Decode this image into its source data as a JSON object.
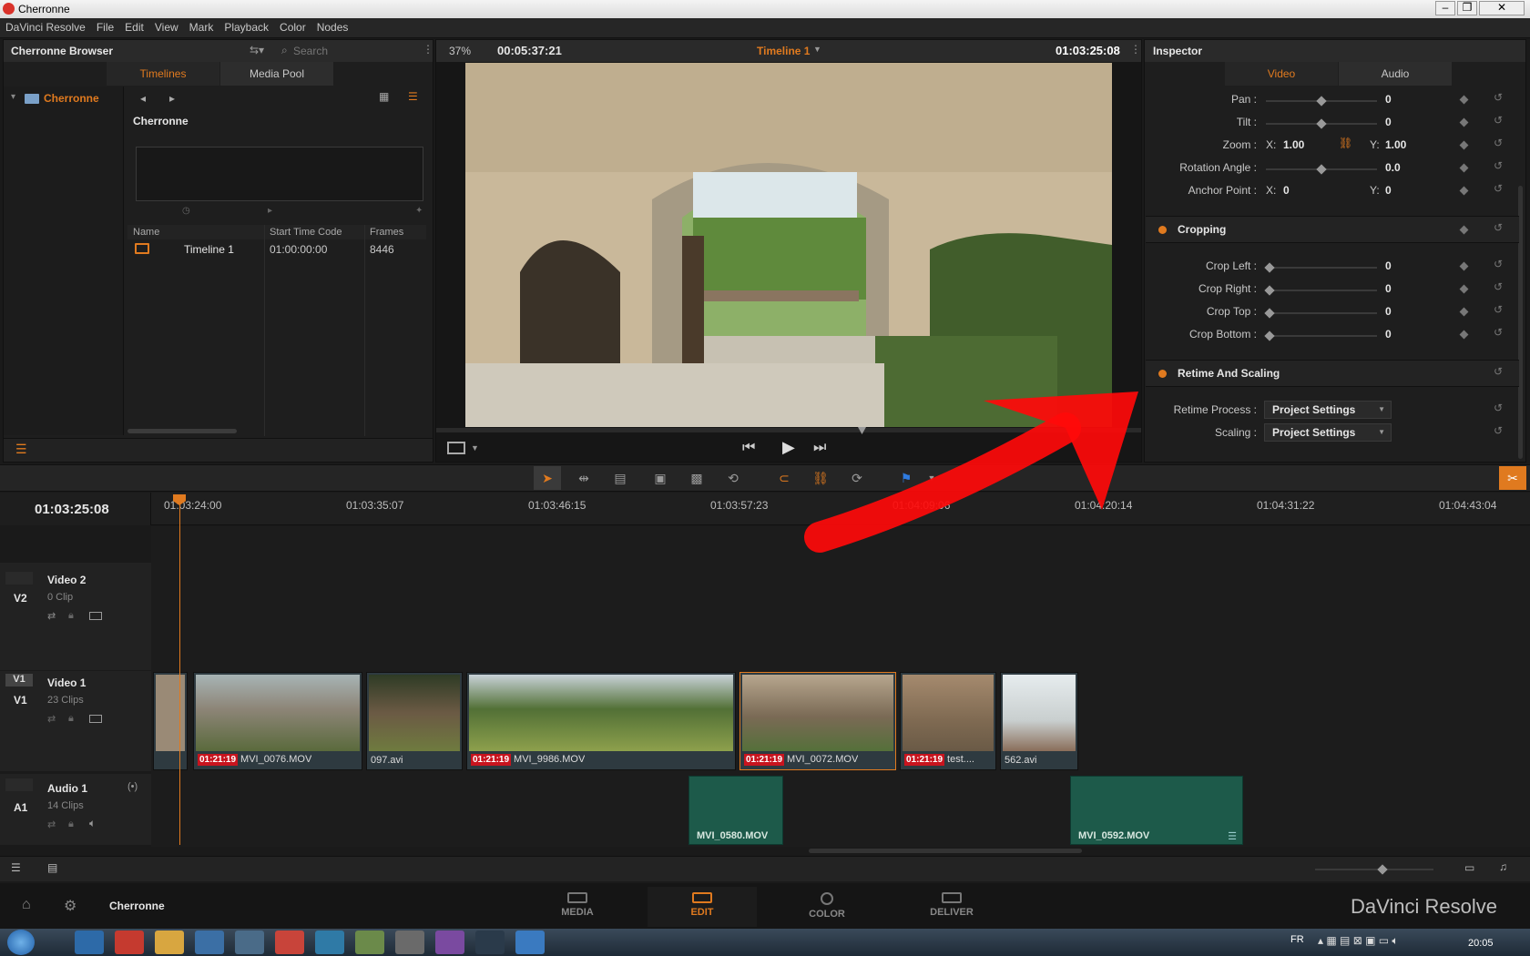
{
  "window": {
    "title": "Cherronne"
  },
  "menu": [
    "DaVinci Resolve",
    "File",
    "Edit",
    "View",
    "Mark",
    "Playback",
    "Color",
    "Nodes"
  ],
  "browser": {
    "title": "Cherronne Browser",
    "search_placeholder": "Search",
    "tabs": [
      "Timelines",
      "Media Pool"
    ],
    "active_tab": "Timelines",
    "tree_item": "Cherronne",
    "folder_title": "Cherronne",
    "columns": [
      "Name",
      "Start Time Code",
      "Frames"
    ],
    "rows": [
      {
        "name": "Timeline 1",
        "start": "01:00:00:00",
        "frames": "8446"
      }
    ]
  },
  "viewer": {
    "zoom": "37%",
    "duration": "00:05:37:21",
    "timeline_name": "Timeline 1",
    "timecode": "01:03:25:08"
  },
  "inspector": {
    "title": "Inspector",
    "tabs": [
      "Video",
      "Audio"
    ],
    "active_tab": "Video",
    "pan": {
      "label": "Pan :",
      "value": "0"
    },
    "tilt": {
      "label": "Tilt :",
      "value": "0"
    },
    "zoom": {
      "label": "Zoom :",
      "x_label": "X:",
      "x": "1.00",
      "y_label": "Y:",
      "y": "1.00"
    },
    "rotation": {
      "label": "Rotation Angle :",
      "value": "0.0"
    },
    "anchor": {
      "label": "Anchor Point :",
      "x_label": "X:",
      "x": "0",
      "y_label": "Y:",
      "y": "0"
    },
    "cropping": {
      "title": "Cropping",
      "left": {
        "label": "Crop Left :",
        "value": "0"
      },
      "right": {
        "label": "Crop Right :",
        "value": "0"
      },
      "top": {
        "label": "Crop Top :",
        "value": "0"
      },
      "bottom": {
        "label": "Crop Bottom :",
        "value": "0"
      }
    },
    "retime": {
      "title": "Retime And Scaling",
      "process": {
        "label": "Retime Process :",
        "value": "Project Settings"
      },
      "scaling": {
        "label": "Scaling :",
        "value": "Project Settings"
      }
    }
  },
  "timeline": {
    "timecode": "01:03:25:08",
    "ruler": [
      "01:03:24:00",
      "01:03:35:07",
      "01:03:46:15",
      "01:03:57:23",
      "01:04:09:06",
      "01:04:20:14",
      "01:04:31:22",
      "01:04:43:04"
    ],
    "tracks": {
      "v2": {
        "id": "V2",
        "name": "Video 2",
        "count": "0 Clip"
      },
      "v1": {
        "id": "V1",
        "name": "Video 1",
        "count": "23 Clips"
      },
      "a1": {
        "id": "A1",
        "name": "Audio 1",
        "count": "14 Clips"
      }
    },
    "video_clips": [
      {
        "name": "",
        "badge": ""
      },
      {
        "name": "MVI_0076.MOV",
        "badge": "01:21:19"
      },
      {
        "name": "097.avi",
        "badge": ""
      },
      {
        "name": "MVI_9986.MOV",
        "badge": "01:21:19"
      },
      {
        "name": "MVI_0072.MOV",
        "badge": "01:21:19"
      },
      {
        "name": "test....",
        "badge": "01:21:19"
      },
      {
        "name": "562.avi",
        "badge": ""
      }
    ],
    "audio_clips": [
      {
        "name": "MVI_0580.MOV"
      },
      {
        "name": "MVI_0592.MOV"
      }
    ]
  },
  "footer": {
    "project": "Cherronne",
    "pages": [
      "MEDIA",
      "EDIT",
      "COLOR",
      "DELIVER"
    ],
    "active_page": "EDIT",
    "brand": "DaVinci Resolve"
  },
  "taskbar": {
    "lang": "FR",
    "clock": "20:05"
  },
  "colors": {
    "accent": "#e07a1f",
    "badge": "#c8141e",
    "audio_clip": "#1d5a4a",
    "annotation_arrow": "#ff0a0a"
  }
}
